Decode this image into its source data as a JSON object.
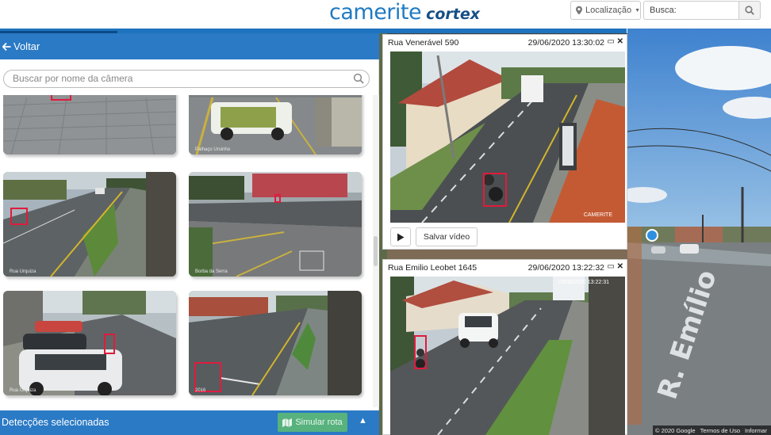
{
  "header": {
    "brand_main": "camerite",
    "brand_sub": "cortex",
    "location_label": "Localização",
    "search_placeholder": "Busca:"
  },
  "left_panel": {
    "back_label": "Voltar",
    "camera_search_placeholder": "Buscar por nome da câmera",
    "thumbnails": [
      {
        "caption": ""
      },
      {
        "caption": "Palhaço Ursinho"
      },
      {
        "caption": "Rua Urquiza"
      },
      {
        "caption": "Borba da Serra"
      },
      {
        "caption": "Rua Urquiza"
      },
      {
        "caption": "2016"
      }
    ],
    "bottom_label": "Detecções selecionadas",
    "simulate_label": "Simular rota"
  },
  "players": [
    {
      "camera_name": "Rua Venerável 590",
      "timestamp": "29/06/2020 13:30:02",
      "overlay": "CAMERITE",
      "save_label": "Salvar vídeo"
    },
    {
      "camera_name": "Rua Emilio Leobet 1645",
      "timestamp": "29/06/2020 13:22:32",
      "overlay": "29/06/2020 13:22:31"
    }
  ],
  "street_view": {
    "street_text": "R. Emílio",
    "footer": [
      "© 2020 Google",
      "Termos de Uso",
      "Informar"
    ]
  },
  "colors": {
    "brand_blue": "#1f7ac2",
    "panel_blue": "#2a7ac5",
    "detection_red": "#e01b3c",
    "simulate_green": "#57b27d"
  },
  "icons": {
    "location": "map-marker-icon",
    "search": "magnifier-icon",
    "back": "arrow-left-icon",
    "route": "map-route-icon",
    "collapse": "chevron-up-icon",
    "play": "play-icon",
    "window": "restore-icon",
    "close": "close-icon"
  }
}
